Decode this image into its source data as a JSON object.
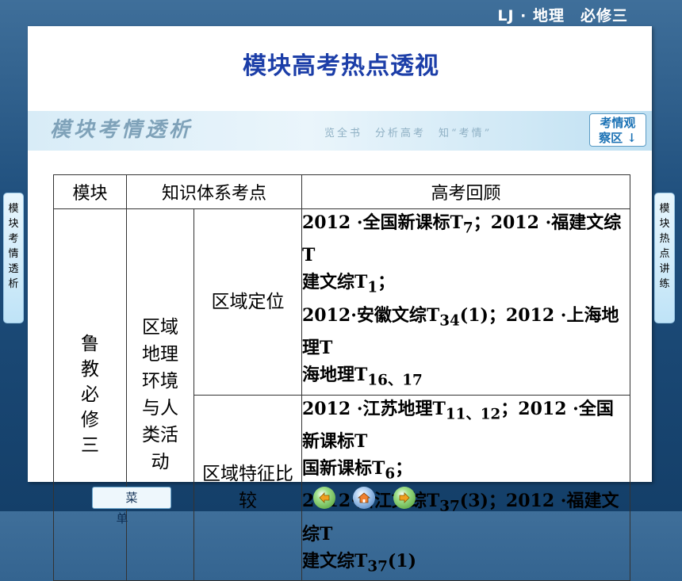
{
  "header": {
    "course": "LJ · 地理　必修三"
  },
  "slide": {
    "title": "模块高考热点透视"
  },
  "banner": {
    "title": "模块考情透析",
    "subtitle": "览全书　分析高考　知“考情”",
    "badge_line1": "考情观",
    "badge_line2": "察区 ↓"
  },
  "table": {
    "headers": {
      "module": "模块",
      "knowledge": "知识体系考点",
      "exam": "高考回顾"
    },
    "module": "鲁教必修三",
    "knowledge_main": "区域地理环境与人类活动",
    "rows": [
      {
        "topic": "区域定位",
        "items": [
          {
            "t": "2012 ·全国新课标T",
            "s": "7",
            "e": "；2012 ·福建文综T"
          },
          {
            "t": "",
            "s": "1",
            "e": "；"
          },
          {
            "t": "2012·安徽文综T",
            "s": "34",
            "e": "(1)；2012 ·上海地理T"
          },
          {
            "t": "",
            "s": "16、17",
            "e": ""
          }
        ]
      },
      {
        "topic": "区域特征比较",
        "items": [
          {
            "t": "2012 ·江苏地理T",
            "s": "11、12",
            "e": "；2012 ·全国新课标T"
          },
          {
            "t": "",
            "s": "6",
            "e": "；"
          },
          {
            "t": "2012·浙江文综T",
            "s": "37",
            "e": "(3)；2012 ·福建文综T"
          },
          {
            "t": "",
            "s": "37",
            "e": "(1)"
          }
        ]
      }
    ]
  },
  "sidebar_left": {
    "label": "模块考情透析"
  },
  "sidebar_right": {
    "label": "模块热点讲练"
  },
  "footer": {
    "menu_label": "菜单",
    "nav_prev": "previous-icon",
    "nav_home": "home-icon",
    "nav_next": "next-icon"
  }
}
